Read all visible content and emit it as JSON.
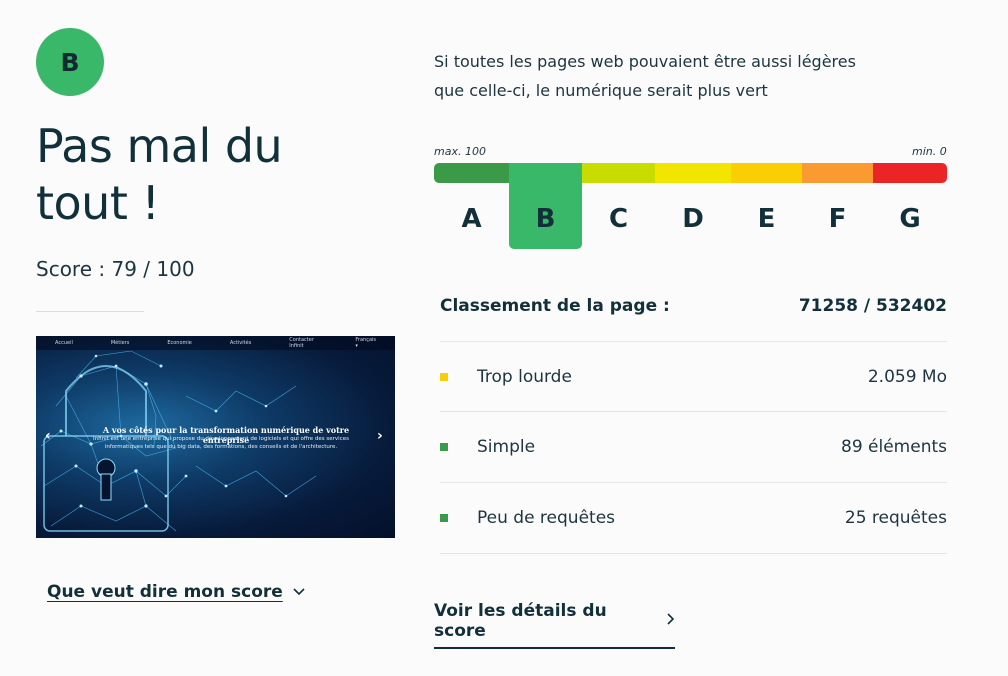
{
  "grade": {
    "letter": "B",
    "verdict": "Pas mal du tout !",
    "score_text": "Score : 79 / 100"
  },
  "screenshot": {
    "nav": [
      "Accueil",
      "Métiers",
      "Economie",
      "Activités",
      "Contacter Infinit",
      "Français ▾"
    ],
    "headline": "A vos côtés pour la transformation numérique de votre entreprise",
    "subtitle": "Infinit est une entreprise qui propose du développement de logiciels et qui offre des services informatiques tels que du big data, des formations, des conseils et de l'architecture."
  },
  "explain_link": "Que veut dire mon score",
  "intro": "Si toutes les pages web pouvaient être aussi légères que celle-ci, le numérique serait plus vert",
  "scale": {
    "max_label": "max. 100",
    "min_label": "min. 0",
    "active": "B",
    "grades": [
      {
        "letter": "A",
        "color": "#3a9a48"
      },
      {
        "letter": "B",
        "color": "#3ab869"
      },
      {
        "letter": "C",
        "color": "#c9dc00"
      },
      {
        "letter": "D",
        "color": "#f2e600"
      },
      {
        "letter": "E",
        "color": "#fbcd05"
      },
      {
        "letter": "F",
        "color": "#fa9b31"
      },
      {
        "letter": "G",
        "color": "#eb2525"
      }
    ]
  },
  "ranking": {
    "label": "Classement de la page :",
    "value": "71258 / 532402"
  },
  "metrics": [
    {
      "label": "Trop lourde",
      "value": "2.059 Mo",
      "status_color": "#fbcd05"
    },
    {
      "label": "Simple",
      "value": "89 éléments",
      "status_color": "#3a9a48"
    },
    {
      "label": "Peu de requêtes",
      "value": "25 requêtes",
      "status_color": "#3a9a48"
    }
  ],
  "details_link": "Voir les détails du score"
}
